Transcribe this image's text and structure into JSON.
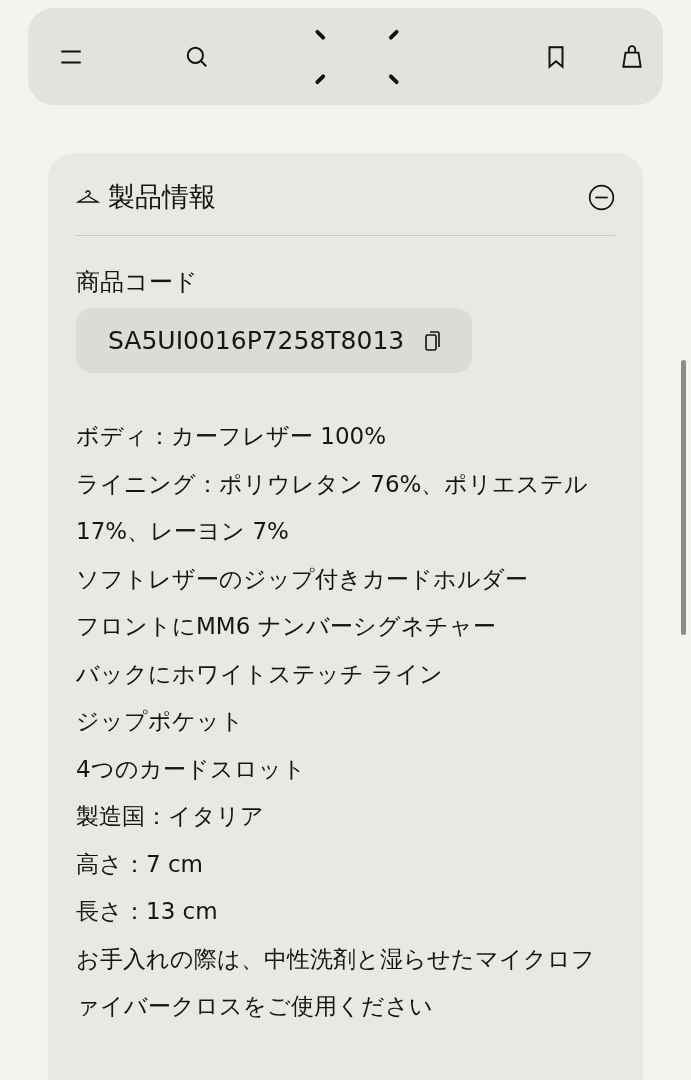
{
  "section": {
    "title": "製品情報",
    "expanded": true,
    "code_label": "商品コード",
    "code": "SA5UI0016P7258T8013",
    "details": [
      "ボディ：カーフレザー 100%",
      "ライニング：ポリウレタン 76%、ポリエステル 17%、レーヨン 7%",
      "ソフトレザーのジップ付きカードホルダー",
      "フロントにMM6 ナンバーシグネチャー",
      "バックにホワイトステッチ ライン",
      "ジップポケット",
      "4つのカードスロット",
      "製造国：イタリア",
      "高さ：7 cm",
      "長さ：13 cm",
      "お手入れの際は、中性洗剤と湿らせたマイクロファイバークロスをご使用ください"
    ]
  }
}
